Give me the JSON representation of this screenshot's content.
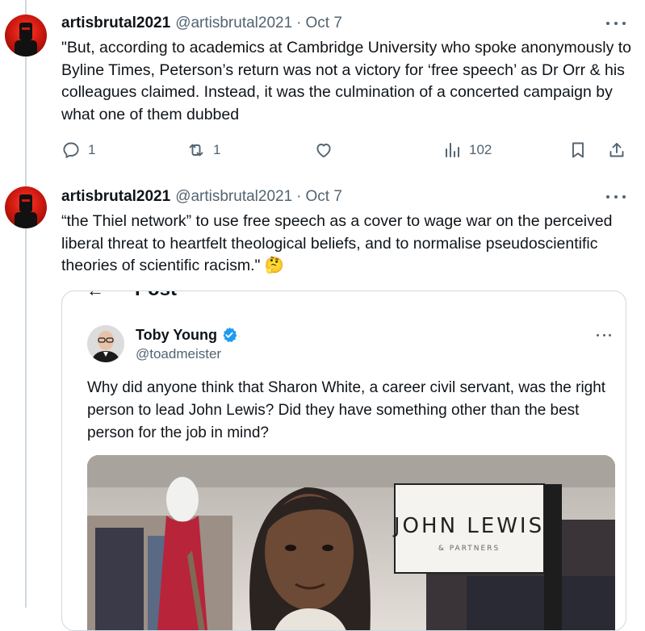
{
  "tweets": [
    {
      "name": "artisbrutal2021",
      "handle": "@artisbrutal2021",
      "separator": "·",
      "date": "Oct 7",
      "text": "\"But, according to academics at Cambridge University who spoke anonymously to Byline Times, Peterson’s return was not a victory for ‘free speech’ as Dr Orr & his  colleagues claimed. Instead, it was the culmination of a concerted  campaign by what one of them dubbed",
      "replies": "1",
      "retweets": "1",
      "likes": "",
      "views": "102"
    },
    {
      "name": "artisbrutal2021",
      "handle": "@artisbrutal2021",
      "separator": "·",
      "date": "Oct 7",
      "text": "“the Thiel network” to use free speech as a cover to wage war on the perceived liberal threat to heartfelt theological beliefs, and to  normalise pseudoscientific theories of scientific racism.\"",
      "emoji": "🤔"
    }
  ],
  "quoted": {
    "header_label": "Post",
    "back_arrow": "←",
    "name": "Toby Young",
    "handle": "@toadmeister",
    "text": "Why did anyone think that Sharon White, a career civil servant, was the right person to lead John Lewis? Did they have something other than the best person for the job in mind?",
    "image_sign": {
      "brand": "JOHN LEWIS",
      "sub": "& PARTNERS"
    }
  },
  "colors": {
    "text": "#0f1419",
    "muted": "#536471",
    "border": "#cfd9de",
    "verified": "#1d9bf0",
    "avatar_red": "#d11a10"
  }
}
